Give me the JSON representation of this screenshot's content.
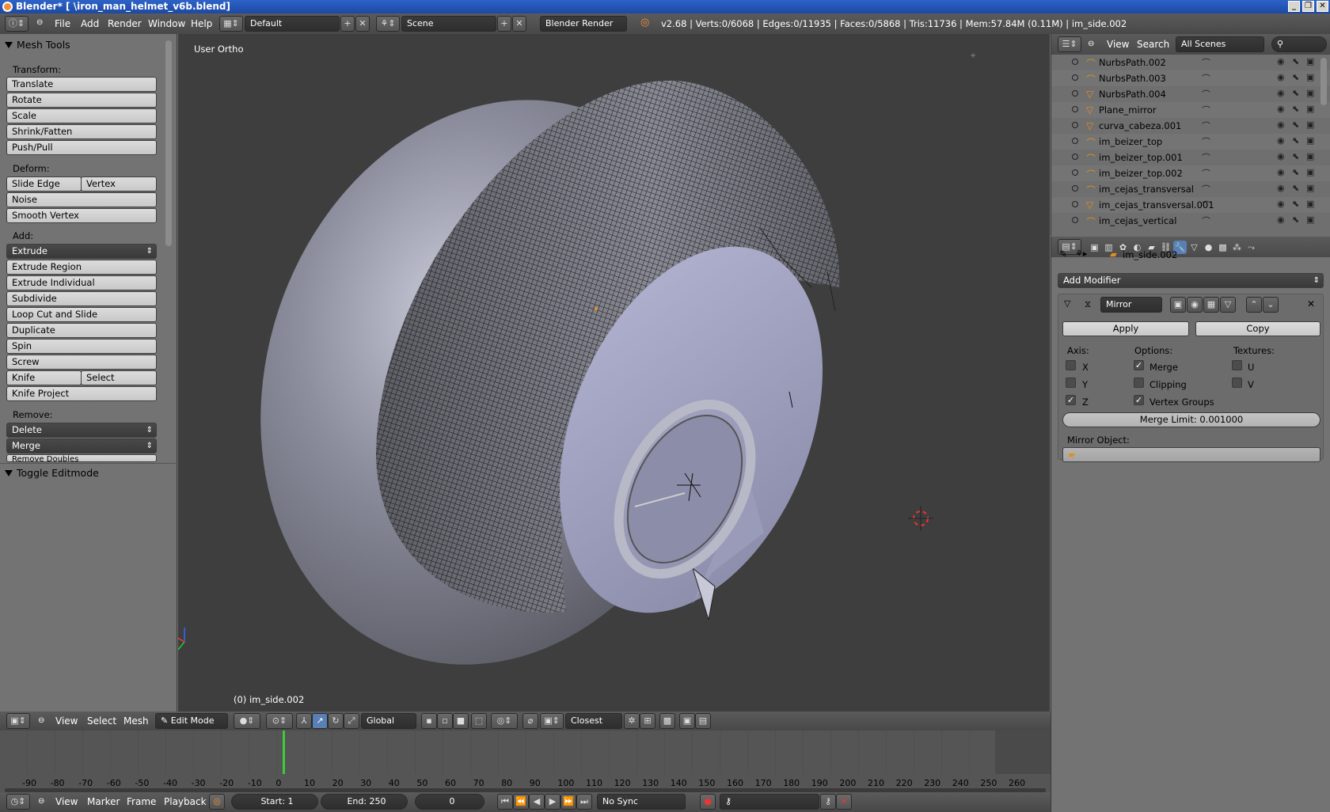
{
  "window": {
    "title": "Blender* [                              \\iron_man_helmet_v6b.blend]",
    "controls": [
      "_",
      "❐",
      "✕"
    ]
  },
  "info_header": {
    "menus": [
      "File",
      "Add",
      "Render",
      "Window",
      "Help"
    ],
    "layout": "Default",
    "scene": "Scene",
    "engine": "Blender Render",
    "stats": "v2.68 | Verts:0/6068 | Edges:0/11935 | Faces:0/5868 | Tris:11736 | Mem:57.84M (0.11M) | im_side.002"
  },
  "tool_shelf": {
    "panel_title": "Mesh Tools",
    "transform_label": "Transform:",
    "transform": [
      "Translate",
      "Rotate",
      "Scale",
      "Shrink/Fatten",
      "Push/Pull"
    ],
    "deform_label": "Deform:",
    "slide_edge": "Slide Edge",
    "vertex": "Vertex",
    "noise": "Noise",
    "smooth_vertex": "Smooth Vertex",
    "add_label": "Add:",
    "extrude": "Extrude",
    "add": [
      "Extrude Region",
      "Extrude Individual",
      "Subdivide",
      "Loop Cut and Slide",
      "Duplicate",
      "Spin",
      "Screw"
    ],
    "knife": "Knife",
    "select": "Select",
    "knife_project": "Knife Project",
    "remove_label": "Remove:",
    "delete": "Delete",
    "merge": "Merge",
    "remove_doubles": "Remove Doubles",
    "toggle_panel": "Toggle Editmode"
  },
  "viewport": {
    "view_label": "User Ortho",
    "object_label": "(0) im_side.002"
  },
  "outliner": {
    "view": "View",
    "search": "Search",
    "filter": "All Scenes",
    "rows": [
      {
        "name": "NurbsPath.002",
        "type": "curve"
      },
      {
        "name": "NurbsPath.003",
        "type": "curve"
      },
      {
        "name": "NurbsPath.004",
        "type": "mesh"
      },
      {
        "name": "Plane_mirror",
        "type": "mesh"
      },
      {
        "name": "curva_cabeza.001",
        "type": "mesh"
      },
      {
        "name": "im_beizer_top",
        "type": "curve"
      },
      {
        "name": "im_beizer_top.001",
        "type": "curve"
      },
      {
        "name": "im_beizer_top.002",
        "type": "curve"
      },
      {
        "name": "im_cejas_transversal",
        "type": "curve"
      },
      {
        "name": "im_cejas_transversal.001",
        "type": "mesh"
      },
      {
        "name": "im_cejas_vertical",
        "type": "curve"
      }
    ]
  },
  "properties": {
    "object": "im_side.002",
    "add_modifier": "Add Modifier",
    "modifier_name": "Mirror",
    "apply": "Apply",
    "copy": "Copy",
    "axis_label": "Axis:",
    "options_label": "Options:",
    "textures_label": "Textures:",
    "axes": [
      {
        "label": "X",
        "checked": false
      },
      {
        "label": "Y",
        "checked": false
      },
      {
        "label": "Z",
        "checked": true
      }
    ],
    "options": [
      {
        "label": "Merge",
        "checked": true
      },
      {
        "label": "Clipping",
        "checked": false
      },
      {
        "label": "Vertex Groups",
        "checked": true
      }
    ],
    "textures": [
      {
        "label": "U",
        "checked": false
      },
      {
        "label": "V",
        "checked": false
      }
    ],
    "merge_limit": "Merge Limit: 0.001000",
    "mirror_object_label": "Mirror Object:"
  },
  "view3d_header": {
    "menus": [
      "View",
      "Select",
      "Mesh"
    ],
    "mode": "Edit Mode",
    "orientation": "Global",
    "snap": "Closest"
  },
  "timeline": {
    "ticks": [
      "-90",
      "-80",
      "-70",
      "-60",
      "-50",
      "-40",
      "-30",
      "-20",
      "-10",
      "0",
      "10",
      "20",
      "30",
      "40",
      "50",
      "60",
      "70",
      "80",
      "90",
      "100",
      "110",
      "120",
      "130",
      "140",
      "150",
      "160",
      "170",
      "180",
      "190",
      "200",
      "210",
      "220",
      "230",
      "240",
      "250",
      "260"
    ],
    "menus": [
      "View",
      "Marker",
      "Frame",
      "Playback"
    ],
    "start": "Start: 1",
    "end": "End: 250",
    "current": "0",
    "sync": "No Sync"
  },
  "colors": {
    "viewport_bg": "#3e3e3e",
    "mesh_light": "#a7a9c4",
    "mesh_dark": "#4a4a50",
    "selection_blue": "#5a7fb5"
  }
}
